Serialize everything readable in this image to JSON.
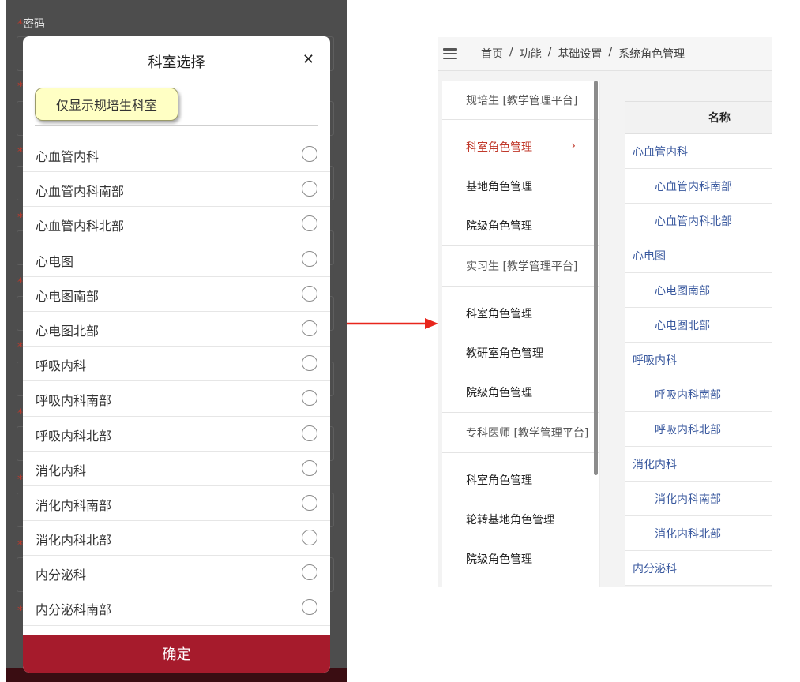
{
  "left_screen": {
    "background_form": {
      "first_label": "密码",
      "required_marker": "*"
    },
    "modal": {
      "title": "科室选择",
      "close_icon": "✕",
      "filter_tooltip": "仅显示规培生科室",
      "departments": [
        "心血管内科",
        "心血管内科南部",
        "心血管内科北部",
        "心电图",
        "心电图南部",
        "心电图北部",
        "呼吸内科",
        "呼吸内科南部",
        "呼吸内科北部",
        "消化内科",
        "消化内科南部",
        "消化内科北部",
        "内分泌科",
        "内分泌科南部"
      ],
      "confirm_label": "确定",
      "confirm_color": "#a61b2c"
    }
  },
  "arrow": {
    "color": "#e8261c"
  },
  "right_screen": {
    "breadcrumb": [
      "首页",
      "功能",
      "基础设置",
      "系统角色管理"
    ],
    "breadcrumb_separator": "/",
    "sidebar": {
      "groups": [
        {
          "title": "规培生 [教学管理平台]",
          "items": [
            "科室角色管理",
            "基地角色管理",
            "院级角色管理"
          ]
        },
        {
          "title": "实习生 [教学管理平台]",
          "items": [
            "科室角色管理",
            "教研室角色管理",
            "院级角色管理"
          ]
        },
        {
          "title": "专科医师 [教学管理平台]",
          "items": [
            "科室角色管理",
            "轮转基地角色管理",
            "院级角色管理"
          ]
        }
      ],
      "active_item": "科室角色管理",
      "active_chevron": "›",
      "active_color": "#c0392b"
    },
    "table": {
      "header": "名称",
      "rows": [
        {
          "name": "心血管内科",
          "level": 0
        },
        {
          "name": "心血管内科南部",
          "level": 1
        },
        {
          "name": "心血管内科北部",
          "level": 1
        },
        {
          "name": "心电图",
          "level": 0
        },
        {
          "name": "心电图南部",
          "level": 1
        },
        {
          "name": "心电图北部",
          "level": 1
        },
        {
          "name": "呼吸内科",
          "level": 0
        },
        {
          "name": "呼吸内科南部",
          "level": 1
        },
        {
          "name": "呼吸内科北部",
          "level": 1
        },
        {
          "name": "消化内科",
          "level": 0
        },
        {
          "name": "消化内科南部",
          "level": 1
        },
        {
          "name": "消化内科北部",
          "level": 1
        },
        {
          "name": "内分泌科",
          "level": 0
        }
      ],
      "link_color": "#3b5a9f"
    }
  }
}
